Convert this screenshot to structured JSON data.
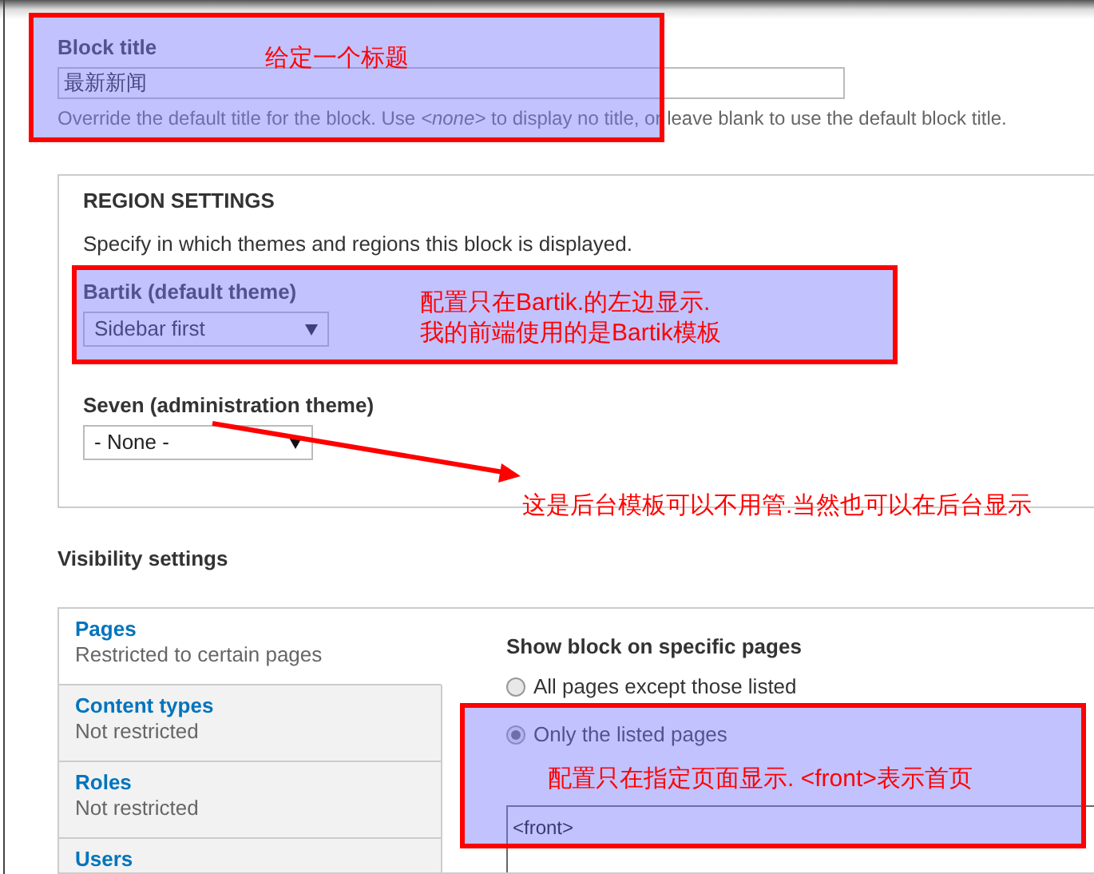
{
  "block_title": {
    "label": "Block title",
    "value": "最新新闻",
    "description": "Override the default title for the block. Use *<none>* to display no title, or leave blank to use the default block title."
  },
  "region_settings": {
    "heading": "REGION SETTINGS",
    "description": "Specify in which themes and regions this block is displayed.",
    "themes": [
      {
        "label": "Bartik (default theme)",
        "value": "Sidebar first"
      },
      {
        "label": "Seven (administration theme)",
        "value": "- None -"
      }
    ]
  },
  "visibility": {
    "heading": "Visibility settings",
    "tabs": [
      {
        "title": "Pages",
        "summary": "Restricted to certain pages",
        "selected": true
      },
      {
        "title": "Content types",
        "summary": "Not restricted",
        "selected": false
      },
      {
        "title": "Roles",
        "summary": "Not restricted",
        "selected": false
      },
      {
        "title": "Users",
        "selected": false
      }
    ],
    "pane": {
      "heading": "Show block on specific pages",
      "options": [
        {
          "label": "All pages except those listed",
          "selected": false
        },
        {
          "label": "Only the listed pages",
          "selected": true
        }
      ],
      "pages": "<front>"
    }
  },
  "annotations": [
    {
      "kind": "box",
      "text": "给定一个标题"
    },
    {
      "kind": "box",
      "text": "配置只在Bartik.的左边显示.\n我的前端使用的是Bartik模板"
    },
    {
      "kind": "arrow",
      "text": "这是后台模板可以不用管.当然也可以在后台显示"
    },
    {
      "kind": "box",
      "text": "配置只在指定页面显示. <front>表示首页"
    }
  ]
}
